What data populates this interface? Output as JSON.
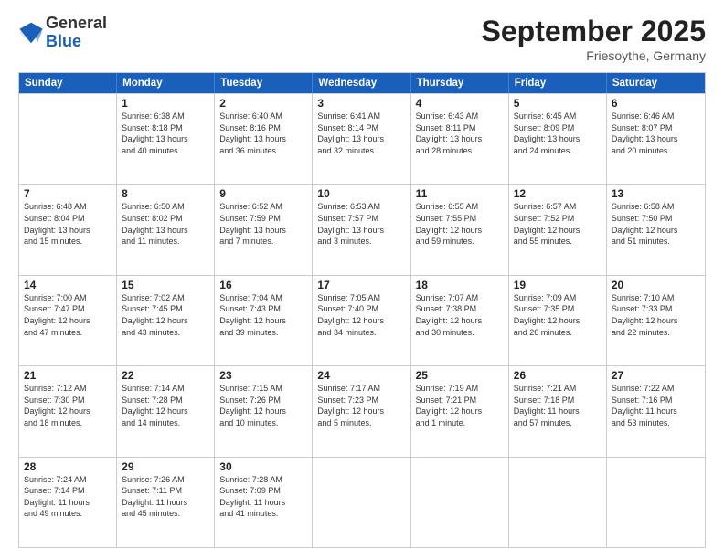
{
  "header": {
    "logo_general": "General",
    "logo_blue": "Blue",
    "month_title": "September 2025",
    "location": "Friesoythe, Germany"
  },
  "days_of_week": [
    "Sunday",
    "Monday",
    "Tuesday",
    "Wednesday",
    "Thursday",
    "Friday",
    "Saturday"
  ],
  "weeks": [
    [
      {
        "day": "",
        "info": ""
      },
      {
        "day": "1",
        "info": "Sunrise: 6:38 AM\nSunset: 8:18 PM\nDaylight: 13 hours\nand 40 minutes."
      },
      {
        "day": "2",
        "info": "Sunrise: 6:40 AM\nSunset: 8:16 PM\nDaylight: 13 hours\nand 36 minutes."
      },
      {
        "day": "3",
        "info": "Sunrise: 6:41 AM\nSunset: 8:14 PM\nDaylight: 13 hours\nand 32 minutes."
      },
      {
        "day": "4",
        "info": "Sunrise: 6:43 AM\nSunset: 8:11 PM\nDaylight: 13 hours\nand 28 minutes."
      },
      {
        "day": "5",
        "info": "Sunrise: 6:45 AM\nSunset: 8:09 PM\nDaylight: 13 hours\nand 24 minutes."
      },
      {
        "day": "6",
        "info": "Sunrise: 6:46 AM\nSunset: 8:07 PM\nDaylight: 13 hours\nand 20 minutes."
      }
    ],
    [
      {
        "day": "7",
        "info": "Sunrise: 6:48 AM\nSunset: 8:04 PM\nDaylight: 13 hours\nand 15 minutes."
      },
      {
        "day": "8",
        "info": "Sunrise: 6:50 AM\nSunset: 8:02 PM\nDaylight: 13 hours\nand 11 minutes."
      },
      {
        "day": "9",
        "info": "Sunrise: 6:52 AM\nSunset: 7:59 PM\nDaylight: 13 hours\nand 7 minutes."
      },
      {
        "day": "10",
        "info": "Sunrise: 6:53 AM\nSunset: 7:57 PM\nDaylight: 13 hours\nand 3 minutes."
      },
      {
        "day": "11",
        "info": "Sunrise: 6:55 AM\nSunset: 7:55 PM\nDaylight: 12 hours\nand 59 minutes."
      },
      {
        "day": "12",
        "info": "Sunrise: 6:57 AM\nSunset: 7:52 PM\nDaylight: 12 hours\nand 55 minutes."
      },
      {
        "day": "13",
        "info": "Sunrise: 6:58 AM\nSunset: 7:50 PM\nDaylight: 12 hours\nand 51 minutes."
      }
    ],
    [
      {
        "day": "14",
        "info": "Sunrise: 7:00 AM\nSunset: 7:47 PM\nDaylight: 12 hours\nand 47 minutes."
      },
      {
        "day": "15",
        "info": "Sunrise: 7:02 AM\nSunset: 7:45 PM\nDaylight: 12 hours\nand 43 minutes."
      },
      {
        "day": "16",
        "info": "Sunrise: 7:04 AM\nSunset: 7:43 PM\nDaylight: 12 hours\nand 39 minutes."
      },
      {
        "day": "17",
        "info": "Sunrise: 7:05 AM\nSunset: 7:40 PM\nDaylight: 12 hours\nand 34 minutes."
      },
      {
        "day": "18",
        "info": "Sunrise: 7:07 AM\nSunset: 7:38 PM\nDaylight: 12 hours\nand 30 minutes."
      },
      {
        "day": "19",
        "info": "Sunrise: 7:09 AM\nSunset: 7:35 PM\nDaylight: 12 hours\nand 26 minutes."
      },
      {
        "day": "20",
        "info": "Sunrise: 7:10 AM\nSunset: 7:33 PM\nDaylight: 12 hours\nand 22 minutes."
      }
    ],
    [
      {
        "day": "21",
        "info": "Sunrise: 7:12 AM\nSunset: 7:30 PM\nDaylight: 12 hours\nand 18 minutes."
      },
      {
        "day": "22",
        "info": "Sunrise: 7:14 AM\nSunset: 7:28 PM\nDaylight: 12 hours\nand 14 minutes."
      },
      {
        "day": "23",
        "info": "Sunrise: 7:15 AM\nSunset: 7:26 PM\nDaylight: 12 hours\nand 10 minutes."
      },
      {
        "day": "24",
        "info": "Sunrise: 7:17 AM\nSunset: 7:23 PM\nDaylight: 12 hours\nand 5 minutes."
      },
      {
        "day": "25",
        "info": "Sunrise: 7:19 AM\nSunset: 7:21 PM\nDaylight: 12 hours\nand 1 minute."
      },
      {
        "day": "26",
        "info": "Sunrise: 7:21 AM\nSunset: 7:18 PM\nDaylight: 11 hours\nand 57 minutes."
      },
      {
        "day": "27",
        "info": "Sunrise: 7:22 AM\nSunset: 7:16 PM\nDaylight: 11 hours\nand 53 minutes."
      }
    ],
    [
      {
        "day": "28",
        "info": "Sunrise: 7:24 AM\nSunset: 7:14 PM\nDaylight: 11 hours\nand 49 minutes."
      },
      {
        "day": "29",
        "info": "Sunrise: 7:26 AM\nSunset: 7:11 PM\nDaylight: 11 hours\nand 45 minutes."
      },
      {
        "day": "30",
        "info": "Sunrise: 7:28 AM\nSunset: 7:09 PM\nDaylight: 11 hours\nand 41 minutes."
      },
      {
        "day": "",
        "info": ""
      },
      {
        "day": "",
        "info": ""
      },
      {
        "day": "",
        "info": ""
      },
      {
        "day": "",
        "info": ""
      }
    ]
  ]
}
